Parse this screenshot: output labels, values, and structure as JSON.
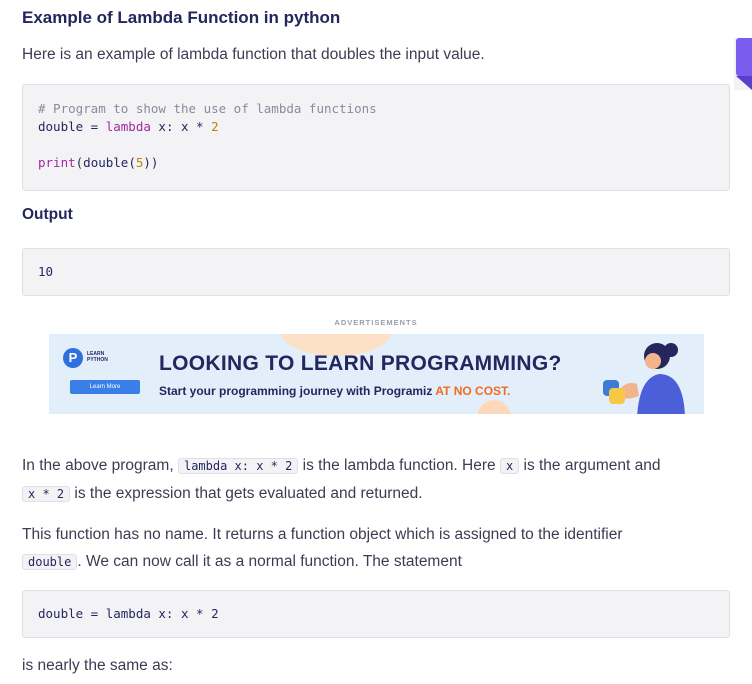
{
  "heading": "Example of Lambda Function in python",
  "intro": "Here is an example of lambda function that doubles the input value.",
  "code1": {
    "comment": "# Program to show the use of lambda functions",
    "line2_a": "double = ",
    "line2_kw": "lambda",
    "line2_b": " x: x * ",
    "line2_num": "2",
    "line3_fn": "print",
    "line3_a": "(double(",
    "line3_num": "5",
    "line3_b": "))"
  },
  "output_heading": "Output",
  "output_value": "10",
  "ad": {
    "label": "ADVERTISEMENTS",
    "logo_letter": "P",
    "logo_text": "LEARN PYTHON",
    "button": "Learn More",
    "title": "LOOKING TO LEARN PROGRAMMING?",
    "subtitle": "Start your programming journey with Programiz ",
    "subtitle_highlight": "AT NO COST."
  },
  "para1": {
    "a": "In the above program, ",
    "code_a": "lambda x: x * 2",
    "b": " is the lambda function. Here ",
    "code_b": "x",
    "c": " is the argument and",
    "code_c": "x * 2",
    "d": " is the expression that gets evaluated and returned."
  },
  "para2": {
    "a": "This function has no name. It returns a function object which is assigned to the identifier",
    "code": "double",
    "b": ". We can now call it as a normal function. The statement"
  },
  "code2": "double = lambda x: x * 2",
  "para3": "is nearly the same as:",
  "colors": {
    "accent": "#7b5cf0",
    "highlight": "#f26b21",
    "text": "#25265e"
  }
}
